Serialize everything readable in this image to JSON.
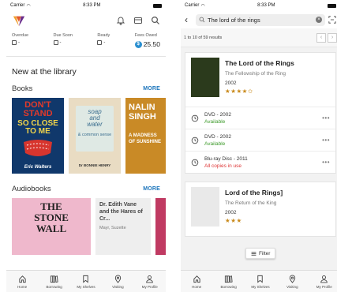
{
  "left": {
    "status": {
      "carrier": "Carrier",
      "time": "8:33 PM"
    },
    "stats": [
      {
        "label": "Overdue",
        "value": "-"
      },
      {
        "label": "Due Soon",
        "value": "-"
      },
      {
        "label": "Ready",
        "value": "-"
      },
      {
        "label": "Fees Owed",
        "value": "25.50"
      }
    ],
    "currency_symbol": "$",
    "new_title": "New at the library",
    "books_section": {
      "title": "Books",
      "more": "MORE"
    },
    "book_covers": [
      {
        "line1": "DON'T",
        "line2": "STAND",
        "line3": "SO CLOSE",
        "line4": "TO ME",
        "author": "Eric Walters",
        "bg": "#10386b"
      },
      {
        "line1": "soap",
        "line2": "and",
        "line3": "water",
        "extra": "& common sense",
        "author": "Dr BONNIE HENRY",
        "bg": "#e9dcc3"
      },
      {
        "line1": "NALIN",
        "line2": "SINGH",
        "line3": "A MADNESS OF SUNSHINE",
        "bg": "#c98a26"
      }
    ],
    "audio_section": {
      "title": "Audiobooks",
      "more": "MORE"
    },
    "audio_covers": [
      {
        "line1": "THE",
        "line2": "STONE",
        "line3": "WALL",
        "bg": "#efb8cc"
      },
      {
        "title": "Dr. Edith Vane and the Hares of Cr...",
        "author": "Mayr, Suzette"
      }
    ],
    "tabs": [
      {
        "label": "Home",
        "icon": "home-icon"
      },
      {
        "label": "Borrowing",
        "icon": "books-icon"
      },
      {
        "label": "My Shelves",
        "icon": "bookmark-icon"
      },
      {
        "label": "Visiting",
        "icon": "location-pin-icon"
      },
      {
        "label": "My Profile",
        "icon": "person-icon"
      }
    ]
  },
  "right": {
    "status": {
      "carrier": "Carrier",
      "time": "8:33 PM"
    },
    "search": {
      "query": "The lord of the rings"
    },
    "results": {
      "count_text": "1 to 10 of 59 results",
      "prev": "‹",
      "next": "›"
    },
    "book1": {
      "title": "The Lord of the Rings",
      "subtitle": "The Fellowship of the Ring",
      "year": "2002",
      "stars": "★★★★✩",
      "formats": [
        {
          "name": "DVD - 2002",
          "status": "Available",
          "kind": "available"
        },
        {
          "name": "DVD - 2002",
          "status": "Available",
          "kind": "available"
        },
        {
          "name": "Blu-ray Disc - 2011",
          "status": "All copies in use",
          "kind": "inuse"
        }
      ]
    },
    "book2": {
      "title": "Lord of the Rings]",
      "subtitle": "The Return of the King",
      "year": "2002",
      "stars": "★★★"
    },
    "filter_label": "Filter",
    "tabs": [
      {
        "label": "Home",
        "icon": "home-icon"
      },
      {
        "label": "Borrowing",
        "icon": "books-icon"
      },
      {
        "label": "My Shelves",
        "icon": "bookmark-icon"
      },
      {
        "label": "Visiting",
        "icon": "location-pin-icon"
      },
      {
        "label": "My Profile",
        "icon": "person-icon"
      }
    ]
  },
  "colors": {
    "accent": "#1c75bc",
    "available": "#3c9a2a",
    "in_use": "#dd3333",
    "star": "#c98a1b",
    "logo_orange": "#f0a030",
    "logo_purple": "#6a2c8a"
  }
}
